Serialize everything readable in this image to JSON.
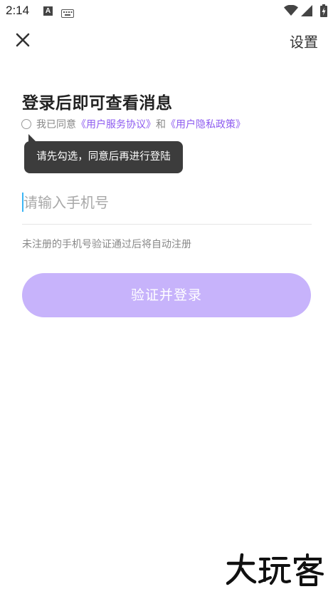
{
  "status_bar": {
    "time": "2:14",
    "a_icon_text": "A",
    "icons": [
      "a-notification-icon",
      "keyboard-icon",
      "wifi-icon",
      "signal-icon",
      "battery-icon"
    ]
  },
  "top_bar": {
    "close_icon": "close-icon",
    "settings_label": "设置"
  },
  "login": {
    "title": "登录后即可查看消息",
    "agree_prefix": "我已同意",
    "user_agreement": "《用户服务协议》",
    "and_text": "和",
    "privacy_policy": "《用户隐私政策》",
    "tooltip": "请先勾选，同意后再进行登陆",
    "phone_placeholder": "请输入手机号",
    "phone_value": "",
    "hint": "未注册的手机号验证通过后将自动注册",
    "submit_label": "验证并登录"
  },
  "colors": {
    "accent_link": "#8e5cf0",
    "button_bg": "#c7b3fb",
    "tooltip_bg": "#3c3c3c",
    "caret": "#3ab5f5"
  },
  "watermark": {
    "text": "大玩客"
  }
}
